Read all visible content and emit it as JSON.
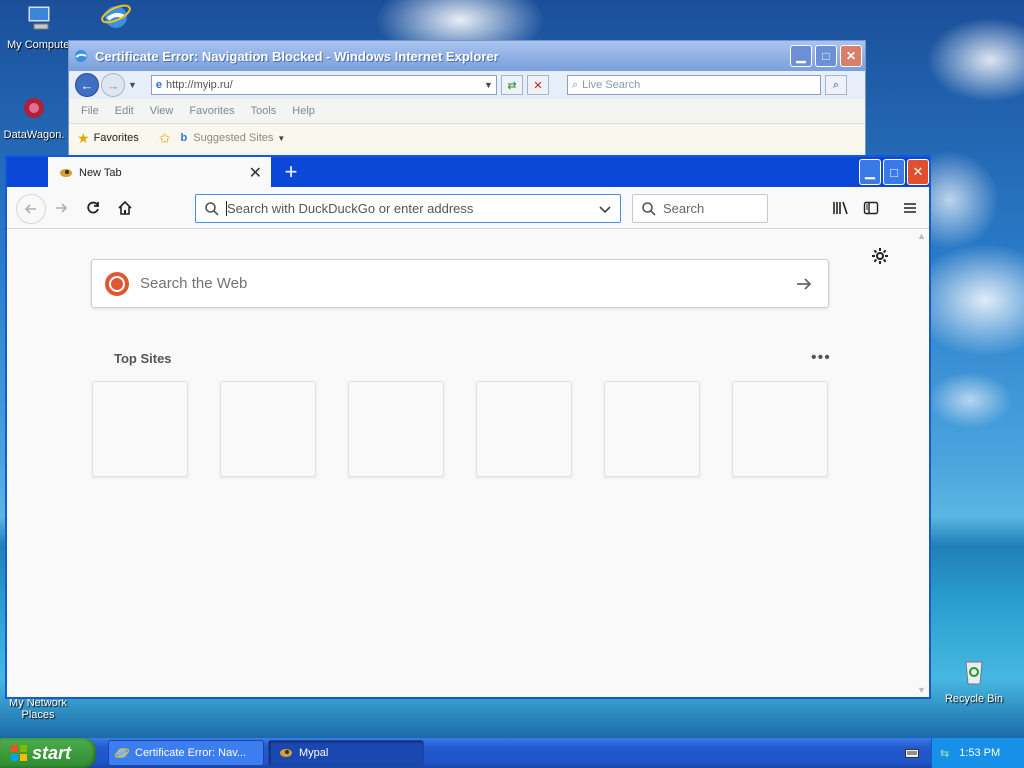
{
  "desktop": {
    "icons": [
      {
        "label": "My Computer",
        "name": "my-computer-icon"
      },
      {
        "label": "DataWagon.",
        "name": "datawagon-icon"
      },
      {
        "label": "My Network Places",
        "name": "network-places-icon"
      },
      {
        "label": "Recycle Bin",
        "name": "recycle-bin-icon"
      }
    ]
  },
  "ie_window": {
    "title": "Certificate Error: Navigation Blocked - Windows Internet Explorer",
    "address": "http://myip.ru/",
    "search_placeholder": "Live Search",
    "menu": [
      "File",
      "Edit",
      "View",
      "Favorites",
      "Tools",
      "Help"
    ],
    "favorites_label": "Favorites",
    "suggested_sites_label": "Suggested Sites"
  },
  "firefox": {
    "tab_title": "New Tab",
    "url_placeholder": "Search with DuckDuckGo or enter address",
    "search_placeholder": "Search",
    "web_search_placeholder": "Search the Web",
    "top_sites_title": "Top Sites",
    "top_sites_count": 6
  },
  "taskbar": {
    "start_label": "start",
    "buttons": [
      {
        "label": "Certificate Error: Nav...",
        "active": false
      },
      {
        "label": "Mypal",
        "active": true
      }
    ],
    "clock": "1:53 PM"
  }
}
